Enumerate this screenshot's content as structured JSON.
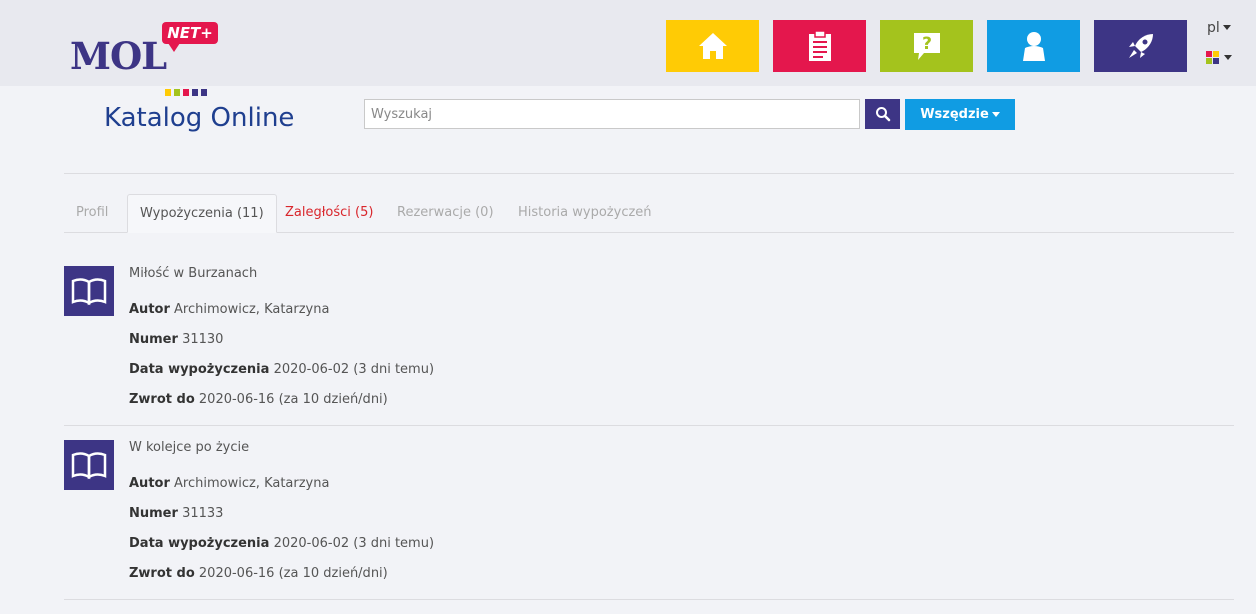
{
  "header": {
    "logo_text": "MOL",
    "logo_badge": "NET+",
    "subtitle": "Katalog Online",
    "tiles": [
      {
        "name": "home-icon",
        "color": "#ffcb05"
      },
      {
        "name": "clipboard-icon",
        "color": "#e4174d"
      },
      {
        "name": "help-icon",
        "color": "#a4c31d"
      },
      {
        "name": "user-icon",
        "color": "#109ce3"
      },
      {
        "name": "rocket-icon",
        "color": "#3d3585"
      }
    ],
    "lang_label": "pl"
  },
  "search": {
    "placeholder": "Wyszukaj",
    "scope_label": "Wszędzie"
  },
  "tabs": [
    {
      "label": "Profil"
    },
    {
      "label": "Wypożyczenia (11)"
    },
    {
      "label": "Zaległości (5)"
    },
    {
      "label": "Rezerwacje (0)"
    },
    {
      "label": "Historia wypożyczeń"
    }
  ],
  "loans": [
    {
      "title": "Miłość w Burzanach",
      "author_label": "Autor",
      "author": "Archimowicz, Katarzyna",
      "number_label": "Numer",
      "number": "31130",
      "loan_date_label": "Data wypożyczenia",
      "loan_date": "2020-06-02 (3 dni temu)",
      "return_label": "Zwrot do",
      "return_date": "2020-06-16 (za 10 dzień/dni)"
    },
    {
      "title": "W kolejce po życie",
      "author_label": "Autor",
      "author": "Archimowicz, Katarzyna",
      "number_label": "Numer",
      "number": "31133",
      "loan_date_label": "Data wypożyczenia",
      "loan_date": "2020-06-02 (3 dni temu)",
      "return_label": "Zwrot do",
      "return_date": "2020-06-16 (za 10 dzień/dni)"
    }
  ]
}
